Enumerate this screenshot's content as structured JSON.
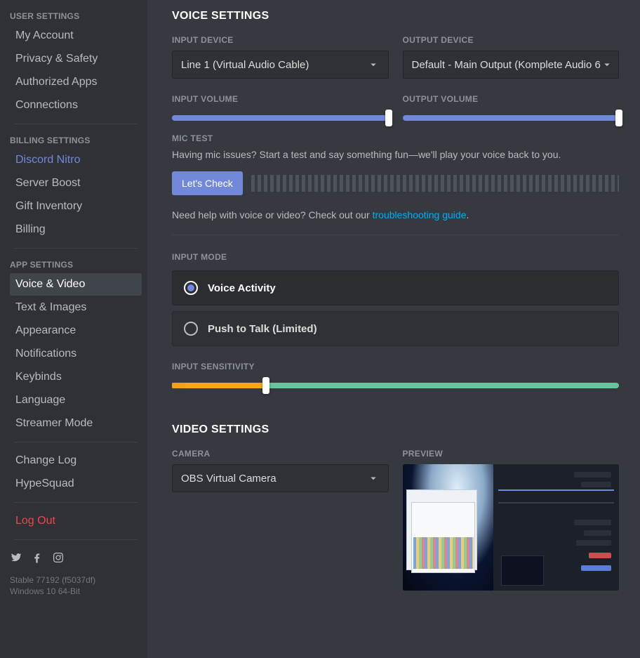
{
  "sidebar": {
    "groups": [
      {
        "header": "USER SETTINGS",
        "items": [
          {
            "label": "My Account",
            "name": "sidebar-item-my-account"
          },
          {
            "label": "Privacy & Safety",
            "name": "sidebar-item-privacy"
          },
          {
            "label": "Authorized Apps",
            "name": "sidebar-item-authorized-apps"
          },
          {
            "label": "Connections",
            "name": "sidebar-item-connections"
          }
        ]
      },
      {
        "header": "BILLING SETTINGS",
        "items": [
          {
            "label": "Discord Nitro",
            "name": "sidebar-item-nitro",
            "cls": "nitro"
          },
          {
            "label": "Server Boost",
            "name": "sidebar-item-server-boost"
          },
          {
            "label": "Gift Inventory",
            "name": "sidebar-item-gift-inventory"
          },
          {
            "label": "Billing",
            "name": "sidebar-item-billing"
          }
        ]
      },
      {
        "header": "APP SETTINGS",
        "items": [
          {
            "label": "Voice & Video",
            "name": "sidebar-item-voice-video",
            "cls": "active"
          },
          {
            "label": "Text & Images",
            "name": "sidebar-item-text-images"
          },
          {
            "label": "Appearance",
            "name": "sidebar-item-appearance"
          },
          {
            "label": "Notifications",
            "name": "sidebar-item-notifications"
          },
          {
            "label": "Keybinds",
            "name": "sidebar-item-keybinds"
          },
          {
            "label": "Language",
            "name": "sidebar-item-language"
          },
          {
            "label": "Streamer Mode",
            "name": "sidebar-item-streamer-mode"
          }
        ]
      },
      {
        "header": "",
        "items": [
          {
            "label": "Change Log",
            "name": "sidebar-item-change-log"
          },
          {
            "label": "HypeSquad",
            "name": "sidebar-item-hypesquad"
          }
        ]
      },
      {
        "header": "",
        "items": [
          {
            "label": "Log Out",
            "name": "sidebar-item-log-out",
            "cls": "logout"
          }
        ]
      }
    ],
    "build": "Stable 77192 (f5037df)",
    "os": "Windows 10 64-Bit"
  },
  "voice": {
    "title": "VOICE SETTINGS",
    "input_device_label": "INPUT DEVICE",
    "input_device_value": "Line 1 (Virtual Audio Cable)",
    "output_device_label": "OUTPUT DEVICE",
    "output_device_value": "Default - Main Output (Komplete Audio 6 ",
    "input_volume_label": "INPUT VOLUME",
    "input_volume_percent": 100,
    "output_volume_label": "OUTPUT VOLUME",
    "output_volume_percent": 100,
    "mic_test_label": "MIC TEST",
    "mic_test_text": "Having mic issues? Start a test and say something fun—we'll play your voice back to you.",
    "lets_check": "Let's Check",
    "help_prefix": "Need help with voice or video? Check out our ",
    "help_link": "troubleshooting guide",
    "help_suffix": ".",
    "input_mode_label": "INPUT MODE",
    "mode_voice_activity": "Voice Activity",
    "mode_ptt": "Push to Talk (Limited)",
    "selected_mode": "voice_activity",
    "input_sensitivity_label": "INPUT SENSITIVITY",
    "input_sensitivity_percent": 21
  },
  "video": {
    "title": "VIDEO SETTINGS",
    "camera_label": "CAMERA",
    "camera_value": "OBS Virtual Camera",
    "preview_label": "PREVIEW"
  }
}
